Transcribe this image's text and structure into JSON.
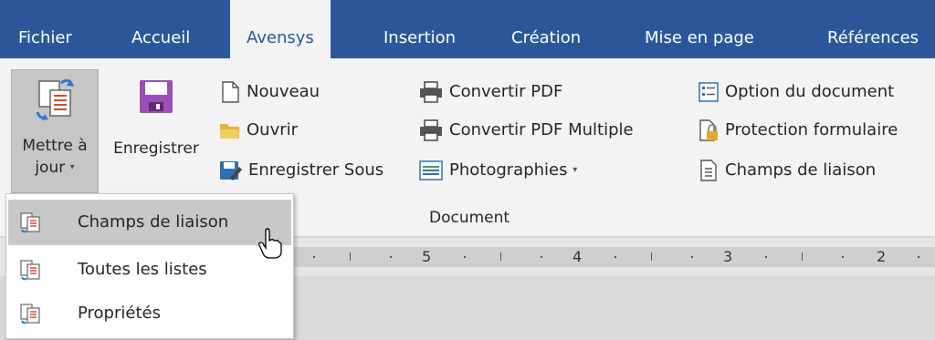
{
  "tabs": [
    {
      "label": "Fichier"
    },
    {
      "label": "Accueil"
    },
    {
      "label": "Avensys",
      "active": true
    },
    {
      "label": "Insertion"
    },
    {
      "label": "Création"
    },
    {
      "label": "Mise en page"
    },
    {
      "label": "Références"
    }
  ],
  "ribbon": {
    "update_button": {
      "line1": "Mettre à",
      "line2": "jour",
      "caret": "▾",
      "icon": "update-fields-icon"
    },
    "save_button": {
      "label": "Enregistrer",
      "icon": "floppy-disk-icon"
    },
    "col1": [
      {
        "label": "Nouveau",
        "icon": "new-document-icon"
      },
      {
        "label": "Ouvrir",
        "icon": "folder-icon"
      },
      {
        "label": "Enregistrer Sous",
        "icon": "save-as-icon"
      }
    ],
    "col2": [
      {
        "label": "Convertir PDF",
        "icon": "printer-icon"
      },
      {
        "label": "Convertir PDF Multiple",
        "icon": "printer-icon"
      },
      {
        "label": "Photographies",
        "caret": "▾",
        "icon": "photos-icon"
      }
    ],
    "col3": [
      {
        "label": "Option du document",
        "icon": "document-options-icon"
      },
      {
        "label": "Protection formulaire",
        "icon": "lock-document-icon"
      },
      {
        "label": "Champs de liaison",
        "icon": "linked-fields-icon"
      }
    ],
    "group_label": "Document"
  },
  "ruler": {
    "labels": [
      "5",
      "4",
      "3",
      "2"
    ]
  },
  "menu": {
    "items": [
      {
        "label": "Champs de liaison",
        "icon": "update-fields-icon",
        "hovered": true
      },
      {
        "label": "Toutes les listes",
        "icon": "update-fields-icon"
      },
      {
        "label": "Propriétés",
        "icon": "update-fields-icon"
      }
    ]
  },
  "colors": {
    "accent": "#2b579a",
    "save_icon": "#9b4fb8",
    "folder": "#f0c040"
  }
}
